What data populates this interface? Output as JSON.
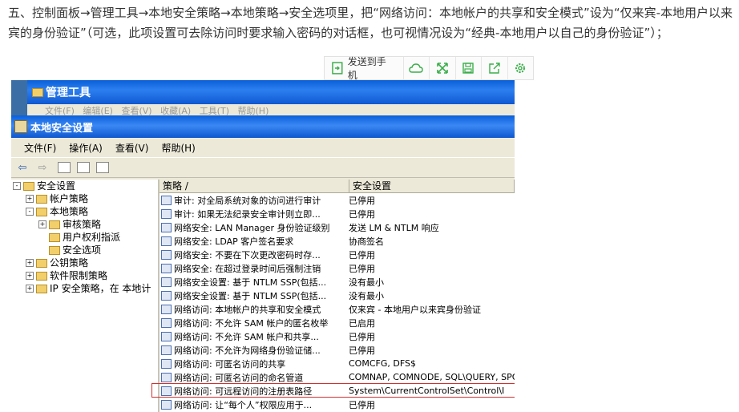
{
  "article": {
    "text": "五、控制面板→管理工具→本地安全策略→本地策略→安全选项里，把“网络访问：本地帐户的共享和安全模式”设为“仅来宾-本地用户以来宾的身份验证”（可选，此项设置可去除访问时要求输入密码的对话框，也可视情况设为“经典-本地用户以自己的身份验证”）；"
  },
  "share_bar": {
    "send_label": "发送到手机",
    "icons": [
      "cloud-icon",
      "expand-icon",
      "save-icon",
      "share-icon",
      "settings-icon"
    ],
    "accent": "#3bae4a"
  },
  "back_window": {
    "title": "管理工具",
    "menu": [
      "文件(F)",
      "编辑(E)",
      "查看(V)",
      "收藏(A)",
      "工具(T)",
      "帮助(H)"
    ]
  },
  "window": {
    "title": "本地安全设置",
    "menu": [
      "文件(F)",
      "操作(A)",
      "查看(V)",
      "帮助(H)"
    ]
  },
  "tree": [
    {
      "label": "安全设置",
      "indent": 0,
      "exp": "-"
    },
    {
      "label": "帐户策略",
      "indent": 1,
      "exp": "+"
    },
    {
      "label": "本地策略",
      "indent": 1,
      "exp": "-"
    },
    {
      "label": "审核策略",
      "indent": 2,
      "exp": "+"
    },
    {
      "label": "用户权利指派",
      "indent": 2,
      "exp": ""
    },
    {
      "label": "安全选项",
      "indent": 2,
      "exp": ""
    },
    {
      "label": "公钥策略",
      "indent": 1,
      "exp": "+"
    },
    {
      "label": "软件限制策略",
      "indent": 1,
      "exp": "+"
    },
    {
      "label": "IP 安全策略，在 本地计",
      "indent": 1,
      "exp": "+"
    }
  ],
  "list": {
    "columns": [
      "策略 /",
      "安全设置"
    ],
    "rows": [
      {
        "policy": "审计: 对全局系统对象的访问进行审计",
        "setting": "已停用"
      },
      {
        "policy": "审计: 如果无法纪录安全审计则立即...",
        "setting": "已停用"
      },
      {
        "policy": "网络安全: LAN Manager 身份验证级别",
        "setting": "发送 LM & NTLM 响应"
      },
      {
        "policy": "网络安全: LDAP 客户签名要求",
        "setting": "协商签名"
      },
      {
        "policy": "网络安全: 不要在下次更改密码时存...",
        "setting": "已停用"
      },
      {
        "policy": "网络安全: 在超过登录时间后强制注销",
        "setting": "已停用"
      },
      {
        "policy": "网络安全设置: 基于 NTLM SSP(包括...",
        "setting": "没有最小"
      },
      {
        "policy": "网络安全设置: 基于 NTLM SSP(包括...",
        "setting": "没有最小"
      },
      {
        "policy": "网络访问: 本地帐户的共享和安全模式",
        "setting": "仅来宾 - 本地用户以来宾身份验证"
      },
      {
        "policy": "网络访问: 不允许 SAM 帐户的匿名枚举",
        "setting": "已启用"
      },
      {
        "policy": "网络访问: 不允许 SAM 帐户和共享...",
        "setting": "已停用"
      },
      {
        "policy": "网络访问: 不允许为网络身份验证储...",
        "setting": "已停用"
      },
      {
        "policy": "网络访问: 可匿名访问的共享",
        "setting": "COMCFG, DFS$"
      },
      {
        "policy": "网络访问: 可匿名访问的命名管道",
        "setting": "COMNAP, COMNODE, SQL\\QUERY, SPOOLSS, I"
      },
      {
        "policy": "网络访问: 可远程访问的注册表路径",
        "setting": "System\\CurrentControlSet\\Control\\I"
      },
      {
        "policy": "网络访问: 让“每个人”权限应用于...",
        "setting": "已停用"
      }
    ],
    "highlight_color": "#d03030"
  }
}
